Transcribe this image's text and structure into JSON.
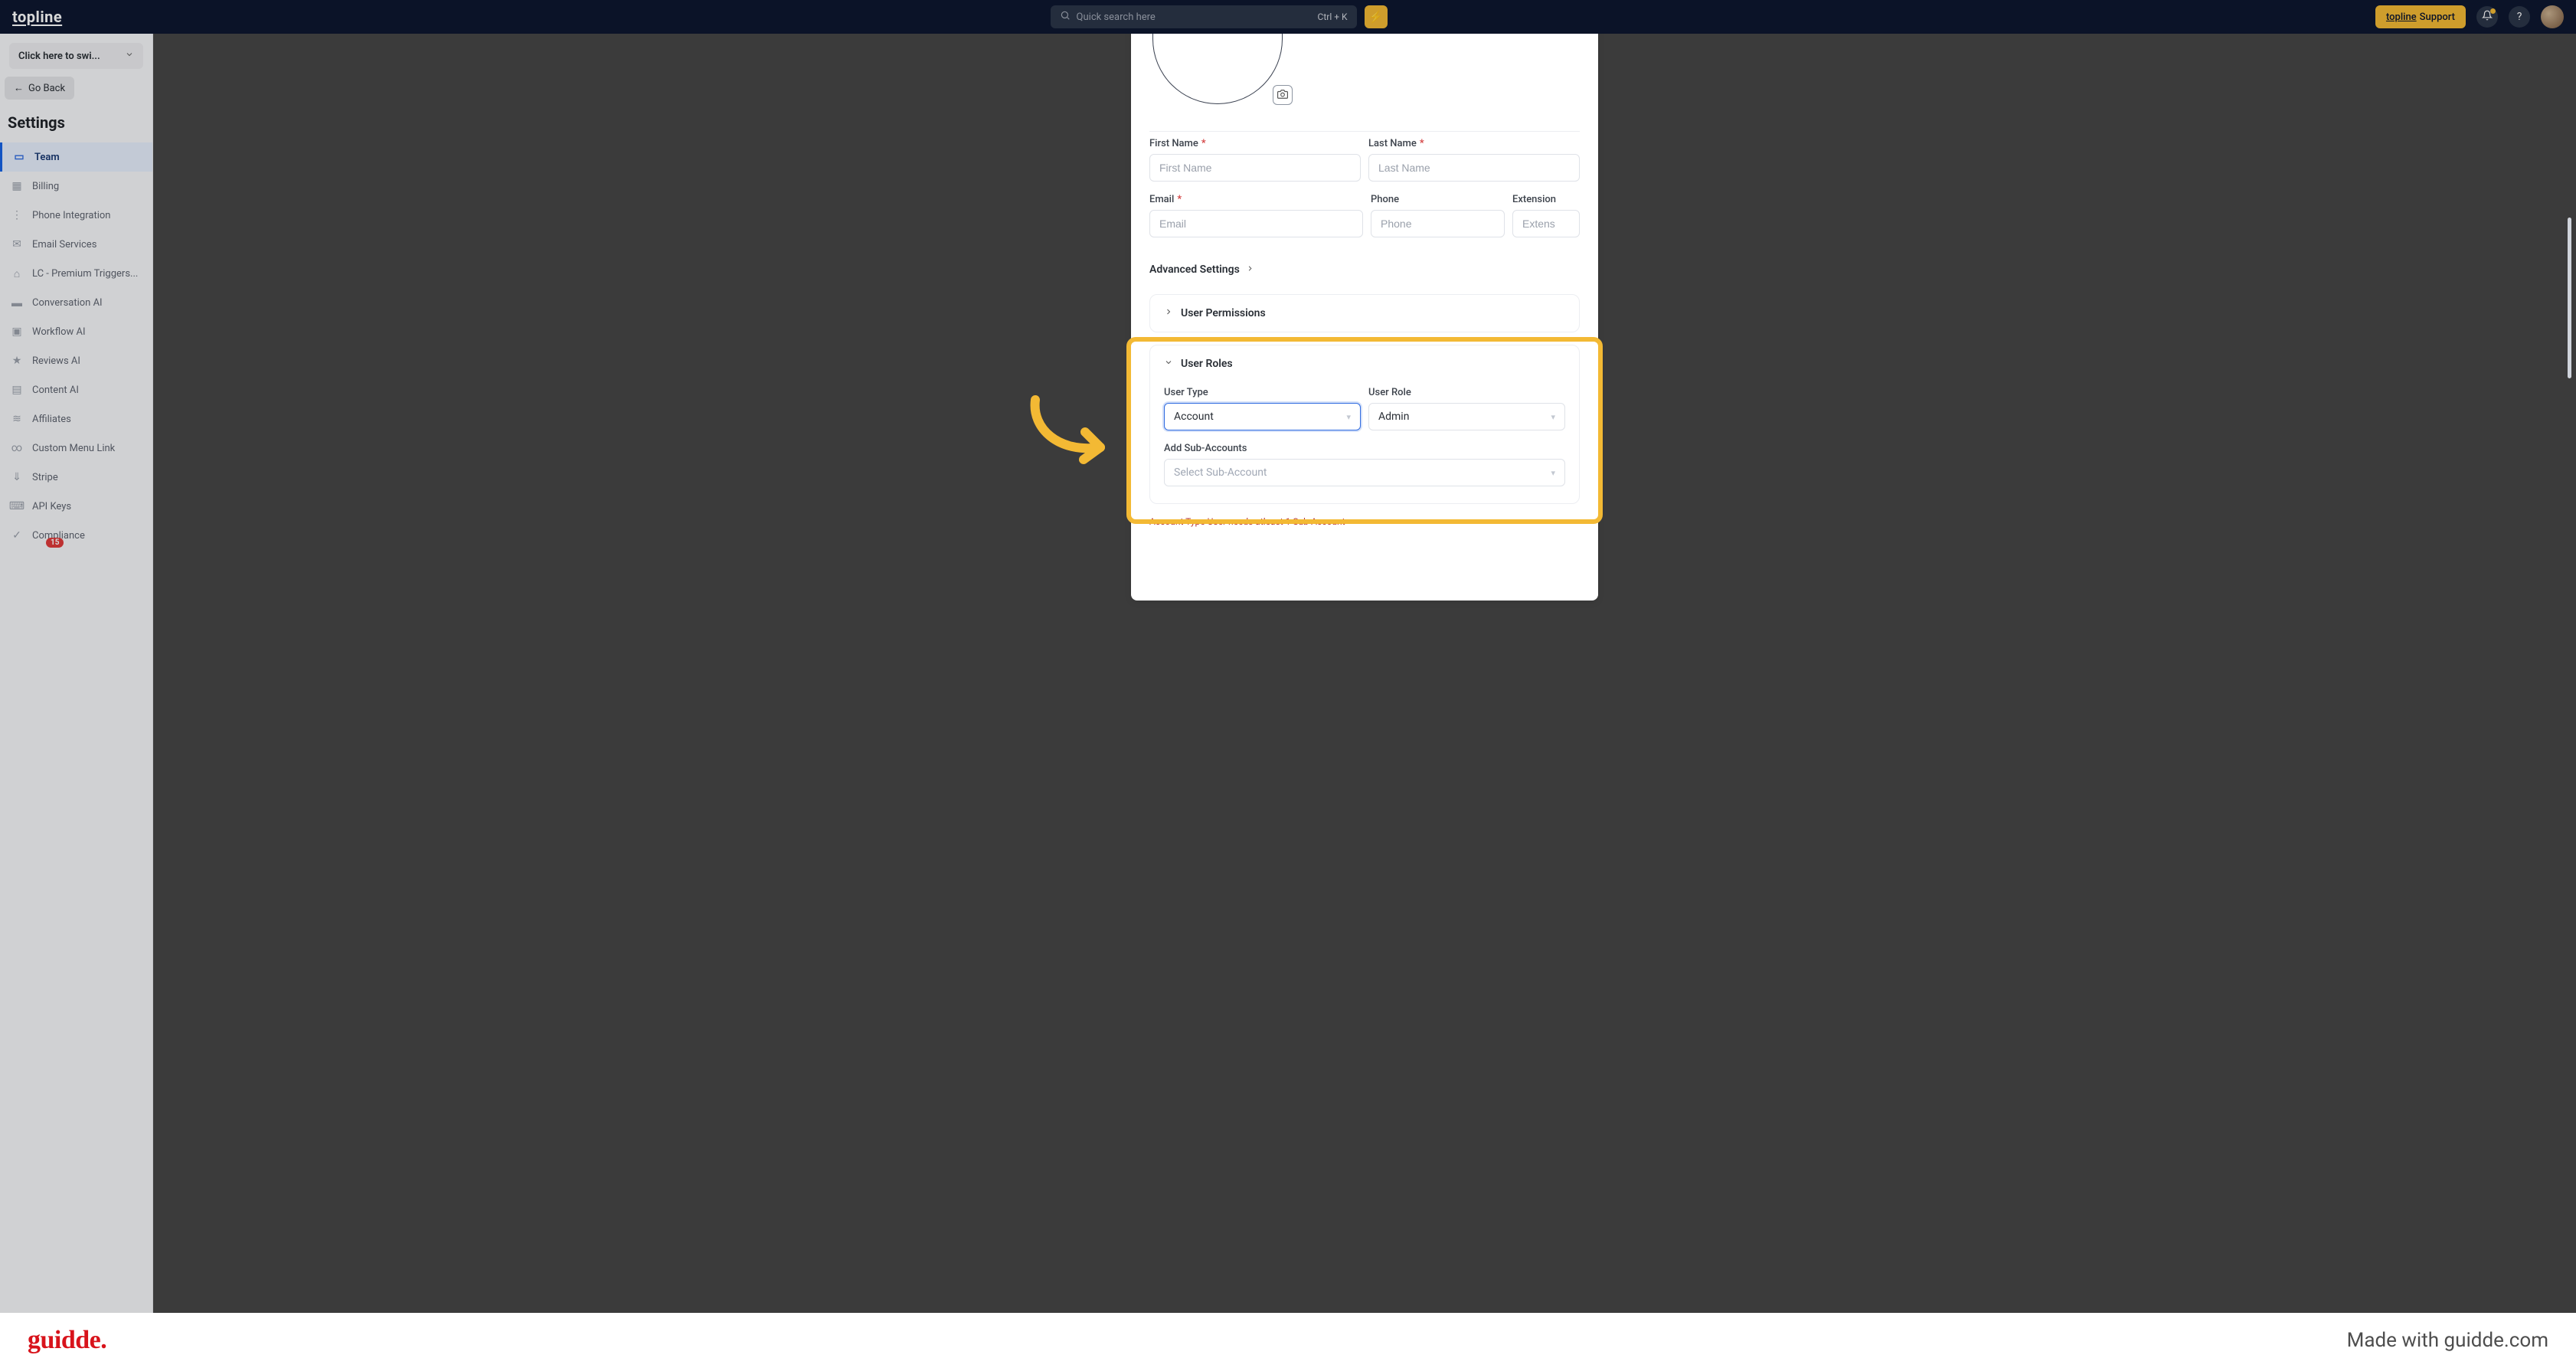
{
  "topbar": {
    "logo": "topline",
    "search_placeholder": "Quick search here",
    "search_kbd": "Ctrl + K",
    "support_brand": "topline",
    "support_label": "Support"
  },
  "sidebar": {
    "switcher_label": "Click here to swi...",
    "goback_label": "Go Back",
    "section_title": "Settings",
    "items": [
      {
        "label": "Team",
        "active": true,
        "icon": "🗔"
      },
      {
        "label": "Billing"
      },
      {
        "label": "Phone Integration"
      },
      {
        "label": "Email Services"
      },
      {
        "label": "LC - Premium Triggers..."
      },
      {
        "label": "Conversation AI"
      },
      {
        "label": "Workflow AI"
      },
      {
        "label": "Reviews AI"
      },
      {
        "label": "Content AI"
      },
      {
        "label": "Affiliates"
      },
      {
        "label": "Custom Menu Link"
      },
      {
        "label": "Stripe"
      },
      {
        "label": "API Keys"
      },
      {
        "label": "Compliance"
      }
    ],
    "badge": "15"
  },
  "form": {
    "first_name": {
      "label": "First Name",
      "placeholder": "First Name",
      "required": true
    },
    "last_name": {
      "label": "Last Name",
      "placeholder": "Last Name",
      "required": true
    },
    "email": {
      "label": "Email",
      "placeholder": "Email",
      "required": true
    },
    "phone": {
      "label": "Phone",
      "placeholder": "Phone"
    },
    "extension": {
      "label": "Extension",
      "placeholder": "Extens"
    },
    "advanced": "Advanced Settings",
    "permissions": "User Permissions",
    "roles_header": "User Roles",
    "user_type_label": "User Type",
    "user_type_value": "Account",
    "user_role_label": "User Role",
    "user_role_value": "Admin",
    "add_sub_label": "Add Sub-Accounts",
    "add_sub_placeholder": "Select Sub-Account",
    "warning": "Account Type User needs atleast 1 Sub-Account"
  },
  "footer": {
    "brand": "guidde.",
    "made_with": "Made with guidde.com"
  }
}
